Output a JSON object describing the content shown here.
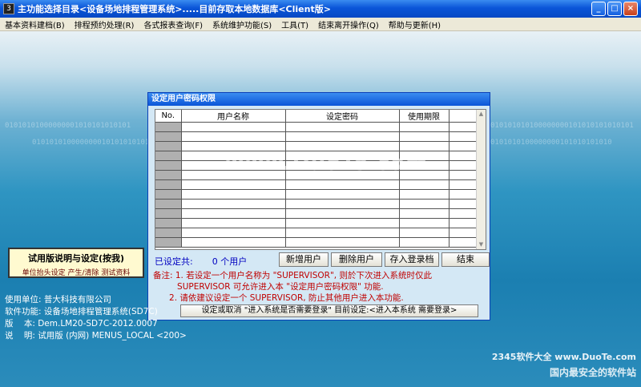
{
  "window": {
    "icon_label": "3",
    "title": "主功能选择目录<设备场地排程管理系统>.....目前存取本地数据库<Client版>",
    "minimize": "_",
    "maximize": "□",
    "close": "×"
  },
  "menu": [
    "基本资料建档(B)",
    "排程预约处理(R)",
    "各式报表查询(F)",
    "系统维护功能(S)",
    "工具(T)",
    "结束离开操作(Q)",
    "帮助与更新(H)"
  ],
  "background": {
    "binary_1": "01010101000000001010101010101",
    "binary_2": "0101010100000000101010101010101",
    "binary_3": "010101010100000000101010101010101",
    "binary_4": "0101010100000000101010101010"
  },
  "dialog": {
    "title": "设定用户密码权限",
    "columns": [
      "No.",
      "用户名称",
      "设定密码",
      "使用期限",
      ""
    ],
    "row_count": 13,
    "count_label": "已设定共:",
    "count_value": "0 个用户",
    "buttons": {
      "add": "新增用户",
      "delete": "删除用户",
      "save": "存入登录档",
      "end": "结束"
    },
    "notes": [
      "备注: 1. 若设定一个用户名称为 \"SUPERVISOR\", 则於下次进入系统时仅此",
      "         SUPERVISOR 可允许进入本 \"设定用户密码权限\" 功能.",
      "      2. 请依建议设定一个 SUPERVISOR, 防止其他用户进入本功能."
    ],
    "toggle_label": "设定或取消 \"进入系统是否需要登录\"  目前设定:<进入本系统 需要登录>"
  },
  "trial": {
    "title": "试用版说明与设定(按我)",
    "sub": "单位抬头设定 产生/清除 测试资料"
  },
  "info": [
    "使用单位: 普大科技有限公司",
    "软件功能: 设备场地排程管理系统(SD7C)",
    "版    本: Dem.LM20-SD7C-2012.0007",
    "说    明: 试用版 (内网) MENUS_LOCAL <200>"
  ],
  "watermark": "www.DuoTe.com",
  "corner_logo": "2345软件大全 www.DuoTe.com",
  "corner_slogan": "国内最安全的软件站"
}
